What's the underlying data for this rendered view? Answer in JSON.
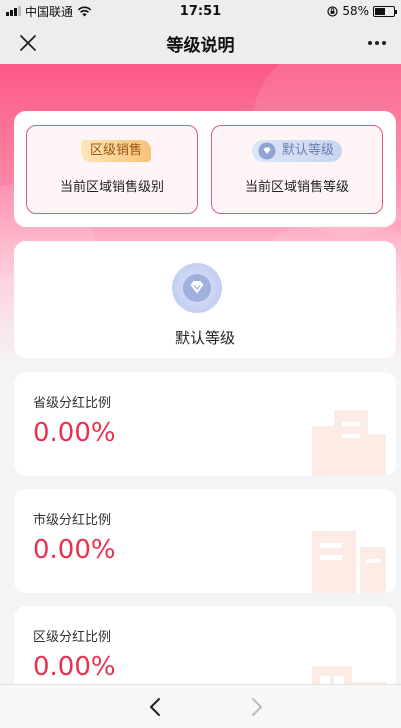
{
  "status_bar": {
    "carrier": "中国联通",
    "time": "17:51",
    "battery_percent": "58%",
    "battery_level": 0.58,
    "icons": [
      "signal-icon",
      "wifi-icon",
      "orientation-lock-icon",
      "battery-icon"
    ]
  },
  "nav": {
    "title": "等级说明",
    "close_icon": "close-icon",
    "more_icon": "more-icon"
  },
  "category_card": {
    "region": {
      "tag": "区级销售",
      "label": "当前区域销售级别"
    },
    "level": {
      "tag": "默认等级",
      "label": "当前区域销售等级",
      "icon": "diamond-icon"
    }
  },
  "level_card": {
    "badge_icon": "diamond-badge-icon",
    "name": "默认等级"
  },
  "rates": [
    {
      "label": "省级分红比例",
      "value": "0.00%"
    },
    {
      "label": "市级分红比例",
      "value": "0.00%"
    },
    {
      "label": "区级分红比例",
      "value": "0.00%"
    }
  ],
  "bottom_nav": {
    "back_icon": "chevron-left-icon",
    "forward_icon": "chevron-right-icon",
    "forward_enabled": false
  },
  "colors": {
    "header_pink": "#fb5a86",
    "accent_red": "#e8334f",
    "tag_orange": "#f7c27a",
    "tag_blue_gray": "#c9d6f0"
  }
}
